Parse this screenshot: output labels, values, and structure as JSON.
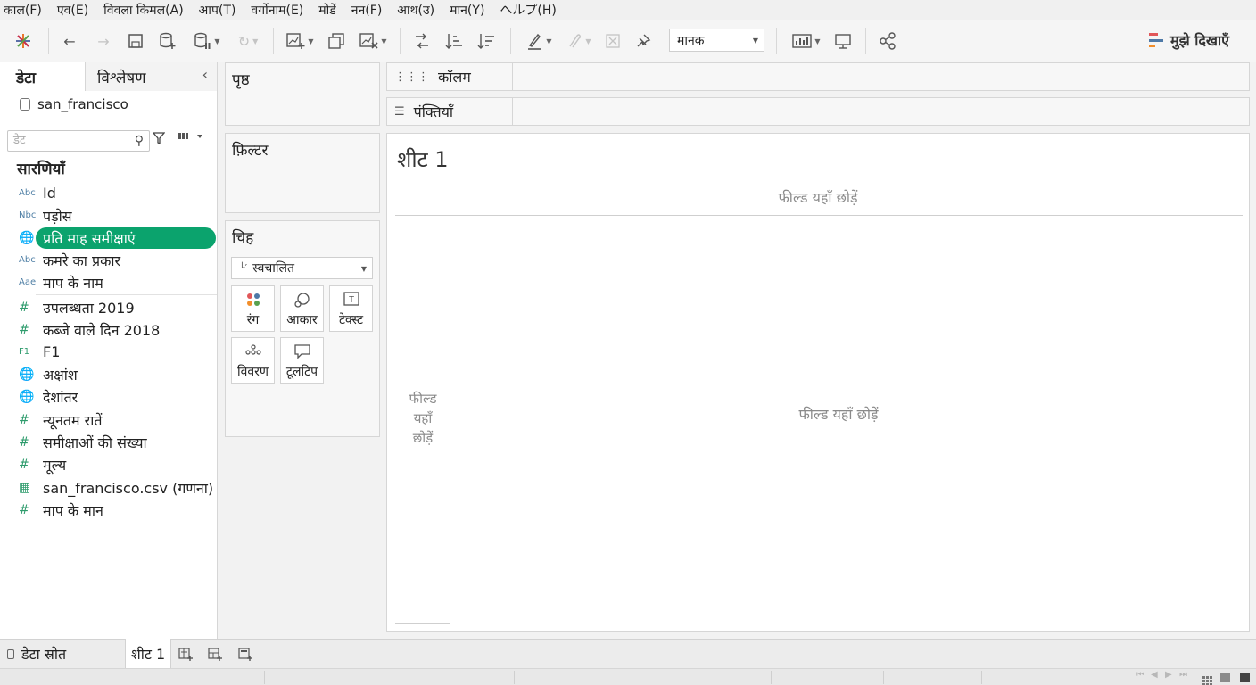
{
  "menu": [
    "काल(F)",
    "एव(E)",
    "विवला किमल(A)",
    "आप(T)",
    "वर्गोनाम(E)",
    "मोडें",
    "नन(F)",
    "आथ(उ)",
    "मान(Y)",
    "ヘルプ(H)"
  ],
  "toolbar": {
    "icons": [
      "tableau-logo-icon",
      "undo-icon",
      "redo-icon",
      "save-icon",
      "add-datasource-icon",
      "pause-icon",
      "refresh-icon",
      "new-sheet-icon",
      "duplicate-icon",
      "clear-icon",
      "swap-icon",
      "sort-asc-icon",
      "sort-desc-icon",
      "highlight-icon",
      "annotate-icon",
      "fixed-axes-icon",
      "pin-icon",
      "show-cards-icon",
      "presentation-icon",
      "share-icon"
    ],
    "fit_value": "मानक",
    "show_me_label": "मुझे दिखाएँ",
    "show_me_colors": [
      "#e15759",
      "#4e79a7",
      "#f28e2b"
    ]
  },
  "data_pane": {
    "tab_data": "डेटा",
    "tab_analysis": "विश्लेषण",
    "datasource": "san_francisco",
    "search_placeholder": "डेट",
    "tables_heading": "सारणियाँ",
    "fields": [
      {
        "type": "Abc",
        "name": "Id"
      },
      {
        "type": "Nbc",
        "name": "पड़ोस"
      },
      {
        "type": "🌐",
        "name": "प्रति माह समीक्षाएं",
        "selected": true
      },
      {
        "type": "Abc",
        "name": "कमरे का प्रकार"
      },
      {
        "type": "Aae",
        "name": "माप के नाम"
      },
      {
        "type": "#",
        "name": "उपलब्धता 2019"
      },
      {
        "type": "#",
        "name": "कब्जे वाले दिन 2018"
      },
      {
        "type": "F1",
        "name": "F1"
      },
      {
        "type": "🌐",
        "name": "अक्षांश"
      },
      {
        "type": "🌐",
        "name": "देशांतर"
      },
      {
        "type": "#",
        "name": "न्यूनतम रातें"
      },
      {
        "type": "#",
        "name": "समीक्षाओं की संख्या"
      },
      {
        "type": "#",
        "name": "मूल्य"
      },
      {
        "type": "▦",
        "name": "san_francisco.csv (गणना)"
      },
      {
        "type": "#",
        "name": "माप के मान"
      }
    ],
    "selected_color": "#0ba36d"
  },
  "cards": {
    "pages": "पृष्ठ",
    "filters": "फ़िल्टर",
    "marks": "चिह",
    "mark_type": "स्वचालित",
    "mark_buttons": [
      "रंग",
      "आकार",
      "टेक्स्ट",
      "विवरण",
      "टूलटिप"
    ]
  },
  "shelves": {
    "columns": "कॉलम",
    "rows": "पंक्तियाँ"
  },
  "view": {
    "sheet_title": "शीट 1",
    "drop_field_top": "फील्ड यहाँ छोड़ें",
    "drop_field_left": [
      "फील्ड",
      "यहाँ",
      "छोड़ें"
    ],
    "drop_field_center": "फील्ड यहाँ छोड़ें"
  },
  "bottom": {
    "datasource_tab": "डेटा स्रोत",
    "sheet_tab": "शीट 1"
  }
}
